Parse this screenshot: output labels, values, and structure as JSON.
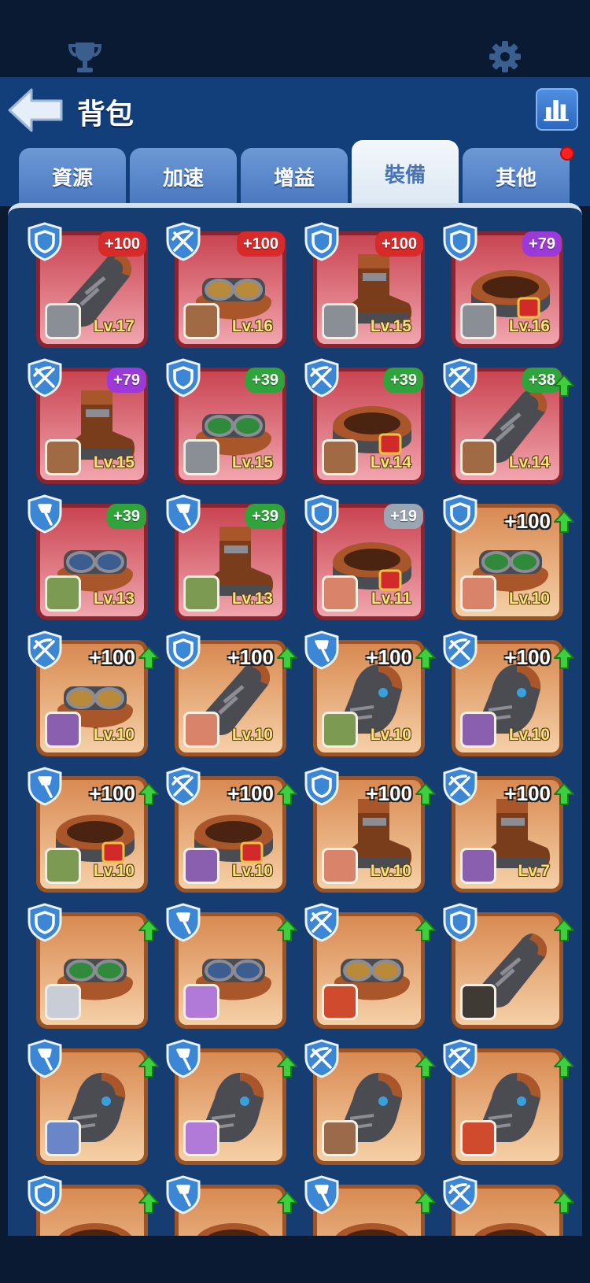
{
  "header": {
    "title": "背包"
  },
  "tabs": [
    {
      "label": "資源",
      "active": false
    },
    {
      "label": "加速",
      "active": false
    },
    {
      "label": "增益",
      "active": false
    },
    {
      "label": "裝備",
      "active": true
    },
    {
      "label": "其他",
      "active": false,
      "badge": true
    }
  ],
  "items": [
    {
      "cls": "shield-icon",
      "gear": "gauntlet",
      "bg": "red",
      "bonus": "+100",
      "bonus_style": "red",
      "level": "Lv.17",
      "hero": "#8a8f96",
      "upgrade": false
    },
    {
      "cls": "crossbow-icon",
      "gear": "goggles",
      "bg": "red",
      "bonus": "+100",
      "bonus_style": "red",
      "level": "Lv.16",
      "hero": "#a06a44",
      "upgrade": false
    },
    {
      "cls": "shield-icon",
      "gear": "boot",
      "bg": "red",
      "bonus": "+100",
      "bonus_style": "red",
      "level": "Lv.15",
      "hero": "#8a8f96",
      "upgrade": false
    },
    {
      "cls": "shield-icon",
      "gear": "belt",
      "bg": "red",
      "bonus": "+79",
      "bonus_style": "purple",
      "level": "Lv.16",
      "hero": "#8a8f96",
      "upgrade": false
    },
    {
      "cls": "crossbow-icon",
      "gear": "boot",
      "bg": "red",
      "bonus": "+79",
      "bonus_style": "purple",
      "level": "Lv.15",
      "hero": "#a06a44",
      "upgrade": false
    },
    {
      "cls": "shield-icon",
      "gear": "goggles-green",
      "bg": "red",
      "bonus": "+39",
      "bonus_style": "green",
      "level": "Lv.15",
      "hero": "#8a8f96",
      "upgrade": false
    },
    {
      "cls": "crossbow-icon",
      "gear": "belt-red",
      "bg": "red",
      "bonus": "+39",
      "bonus_style": "green",
      "level": "Lv.14",
      "hero": "#a06a44",
      "upgrade": false
    },
    {
      "cls": "crossbow-icon",
      "gear": "gauntlet",
      "bg": "red",
      "bonus": "+38",
      "bonus_style": "green",
      "level": "Lv.14",
      "hero": "#a06a44",
      "upgrade": true
    },
    {
      "cls": "wand-icon",
      "gear": "goggles-blue",
      "bg": "red",
      "bonus": "+39",
      "bonus_style": "green",
      "level": "Lv.13",
      "hero": "#7d9a52",
      "upgrade": false
    },
    {
      "cls": "wand-icon",
      "gear": "boot",
      "bg": "red",
      "bonus": "+39",
      "bonus_style": "green",
      "level": "Lv.13",
      "hero": "#7d9a52",
      "upgrade": false
    },
    {
      "cls": "shield-icon",
      "gear": "belt",
      "bg": "red",
      "bonus": "+19",
      "bonus_style": "gray",
      "level": "Lv.11",
      "hero": "#d9836a",
      "upgrade": false
    },
    {
      "cls": "shield-icon",
      "gear": "goggles-green",
      "bg": "orange",
      "bonus": "+100",
      "bonus_style": "plain",
      "level": "Lv.10",
      "hero": "#d9836a",
      "upgrade": true
    },
    {
      "cls": "crossbow-icon",
      "gear": "goggles",
      "bg": "orange",
      "bonus": "+100",
      "bonus_style": "plain",
      "level": "Lv.10",
      "hero": "#8a5fb0",
      "upgrade": true
    },
    {
      "cls": "shield-icon",
      "gear": "gauntlet",
      "bg": "orange",
      "bonus": "+100",
      "bonus_style": "plain",
      "level": "Lv.10",
      "hero": "#d9836a",
      "upgrade": true
    },
    {
      "cls": "wand-icon",
      "gear": "glove",
      "bg": "orange",
      "bonus": "+100",
      "bonus_style": "plain",
      "level": "Lv.10",
      "hero": "#7d9a52",
      "upgrade": true
    },
    {
      "cls": "crossbow-icon",
      "gear": "glove",
      "bg": "orange",
      "bonus": "+100",
      "bonus_style": "plain",
      "level": "Lv.10",
      "hero": "#8a5fb0",
      "upgrade": true
    },
    {
      "cls": "wand-icon",
      "gear": "belt-red",
      "bg": "orange",
      "bonus": "+100",
      "bonus_style": "plain",
      "level": "Lv.10",
      "hero": "#7d9a52",
      "upgrade": true
    },
    {
      "cls": "crossbow-icon",
      "gear": "belt-red",
      "bg": "orange",
      "bonus": "+100",
      "bonus_style": "plain",
      "level": "Lv.10",
      "hero": "#8a5fb0",
      "upgrade": true
    },
    {
      "cls": "shield-icon",
      "gear": "boot",
      "bg": "orange",
      "bonus": "+100",
      "bonus_style": "plain",
      "level": "Lv.10",
      "hero": "#d9836a",
      "upgrade": true
    },
    {
      "cls": "crossbow-icon",
      "gear": "boot",
      "bg": "orange",
      "bonus": "+100",
      "bonus_style": "plain",
      "level": "Lv.7",
      "hero": "#8a5fb0",
      "upgrade": true
    },
    {
      "cls": "shield-icon",
      "gear": "goggles-green",
      "bg": "orange",
      "bonus": "",
      "bonus_style": "plain",
      "level": "",
      "hero": "#c9ced6",
      "upgrade": true
    },
    {
      "cls": "wand-icon",
      "gear": "goggles-blue",
      "bg": "orange",
      "bonus": "",
      "bonus_style": "plain",
      "level": "",
      "hero": "#b27ad8",
      "upgrade": true
    },
    {
      "cls": "crossbow-icon",
      "gear": "goggles",
      "bg": "orange",
      "bonus": "",
      "bonus_style": "plain",
      "level": "",
      "hero": "#d04a2e",
      "upgrade": true
    },
    {
      "cls": "shield-icon",
      "gear": "gauntlet",
      "bg": "orange",
      "bonus": "",
      "bonus_style": "plain",
      "level": "",
      "hero": "#3f3a34",
      "upgrade": true
    },
    {
      "cls": "wand-icon",
      "gear": "glove",
      "bg": "orange",
      "bonus": "",
      "bonus_style": "plain",
      "level": "",
      "hero": "#6a86c9",
      "upgrade": true
    },
    {
      "cls": "wand-icon",
      "gear": "glove",
      "bg": "orange",
      "bonus": "",
      "bonus_style": "plain",
      "level": "",
      "hero": "#b27ad8",
      "upgrade": true
    },
    {
      "cls": "crossbow-icon",
      "gear": "glove",
      "bg": "orange",
      "bonus": "",
      "bonus_style": "plain",
      "level": "",
      "hero": "#9a6a4a",
      "upgrade": true
    },
    {
      "cls": "crossbow-icon",
      "gear": "glove",
      "bg": "orange",
      "bonus": "",
      "bonus_style": "plain",
      "level": "",
      "hero": "#d04a2e",
      "upgrade": true
    },
    {
      "cls": "shield-icon",
      "gear": "belt",
      "bg": "orange",
      "bonus": "",
      "bonus_style": "plain",
      "level": "",
      "hero": "",
      "upgrade": true
    },
    {
      "cls": "wand-icon",
      "gear": "belt",
      "bg": "orange",
      "bonus": "",
      "bonus_style": "plain",
      "level": "",
      "hero": "",
      "upgrade": true
    },
    {
      "cls": "wand-icon",
      "gear": "belt",
      "bg": "orange",
      "bonus": "",
      "bonus_style": "plain",
      "level": "",
      "hero": "",
      "upgrade": true
    },
    {
      "cls": "crossbow-icon",
      "gear": "belt",
      "bg": "orange",
      "bonus": "",
      "bonus_style": "plain",
      "level": "",
      "hero": "",
      "upgrade": true
    }
  ]
}
